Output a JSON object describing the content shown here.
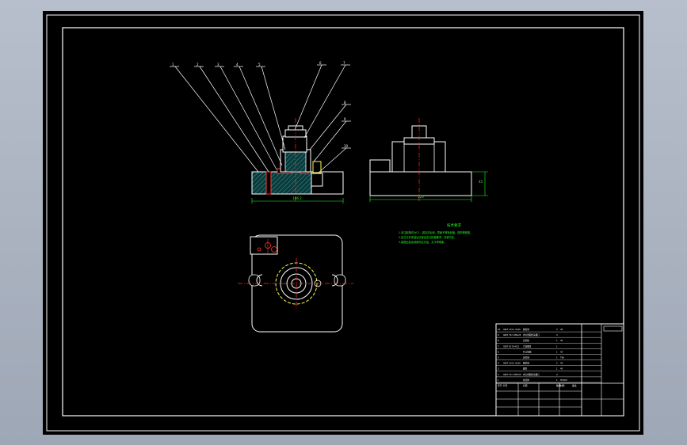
{
  "colors": {
    "background": "#000000",
    "frame": "#ffffff",
    "hatch": "#2e7d7d",
    "centerline": "#ff2a2a",
    "notes": "#22ff22",
    "dimension": "#22ff22",
    "part_outline": "#ffffff",
    "bore": "#ffff44"
  },
  "notes": {
    "title": "技术要求",
    "lines": [
      "1.未注倒角均为C1，锐边去毛刺，表面不得有划痕、碰伤等缺陷。",
      "2.定位元件安装后应保证定位精度要求，夹紧可靠。",
      "3.装配后各运动部件应灵活，无卡滞现象。"
    ]
  },
  "dimensions": {
    "front_width": "106.2",
    "side_width": "125",
    "side_height": "45"
  },
  "balloons": [
    "1",
    "2",
    "3",
    "4",
    "5",
    "6",
    "7",
    "8",
    "9",
    "10"
  ],
  "bom": {
    "rows": [
      [
        "10",
        "GB/T 119.1 6x20",
        "圆柱销",
        "2",
        "45",
        ""
      ],
      [
        "9",
        "GB/T 70.1 M6x25",
        "内六角圆柱头螺钉",
        "4",
        "",
        ""
      ],
      [
        "8",
        "",
        "定位板",
        "1",
        "45",
        ""
      ],
      [
        "7",
        "GB/T 6170 M12",
        "六角螺母",
        "1",
        "",
        ""
      ],
      [
        "6",
        "",
        "开口垫圈",
        "1",
        "45",
        ""
      ],
      [
        "5",
        "",
        "定位销",
        "1",
        "T8A",
        ""
      ],
      [
        "4",
        "GB/T 119.1 8x30",
        "圆柱销",
        "2",
        "45",
        ""
      ],
      [
        "3",
        "",
        "螺柱",
        "1",
        "45",
        ""
      ],
      [
        "2",
        "GB/T 70.1 M8x30",
        "内六角圆柱头螺钉",
        "4",
        "",
        ""
      ],
      [
        "1",
        "",
        "夹具体",
        "1",
        "HT200",
        ""
      ]
    ],
    "header": [
      "序号",
      "代号",
      "名称",
      "数量",
      "材料",
      "备注"
    ]
  }
}
